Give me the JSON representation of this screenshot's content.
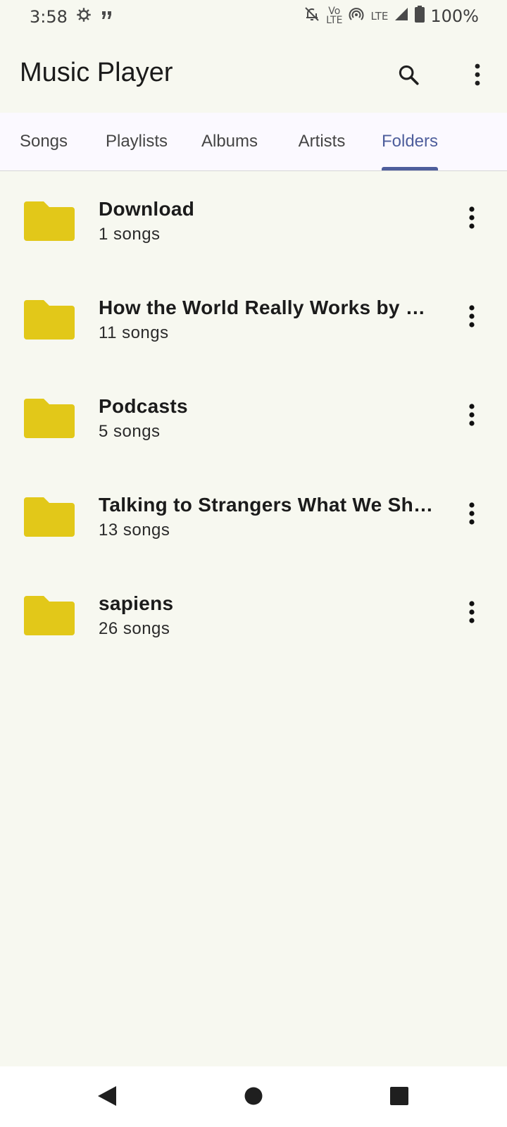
{
  "status_bar": {
    "time": "3:58",
    "volte_top": "Vo",
    "volte_bottom": "LTE",
    "network": "LTE",
    "battery": "100%"
  },
  "app_bar": {
    "title": "Music Player"
  },
  "tabs": [
    {
      "label": "Songs",
      "active": false
    },
    {
      "label": "Playlists",
      "active": false
    },
    {
      "label": "Albums",
      "active": false
    },
    {
      "label": "Artists",
      "active": false
    },
    {
      "label": "Folders",
      "active": true
    }
  ],
  "folders": [
    {
      "name": "Download",
      "count": "1 songs"
    },
    {
      "name": "How the World Really Works by Vac…",
      "count": "11 songs"
    },
    {
      "name": "Podcasts",
      "count": "5 songs"
    },
    {
      "name": "Talking to Strangers What We Shou…",
      "count": "13 songs"
    },
    {
      "name": "sapiens",
      "count": "26 songs"
    }
  ],
  "colors": {
    "accent": "#4e5e9c",
    "folder": "#e2c819",
    "background": "#f7f8f0"
  },
  "icons": {
    "status": [
      "gear-icon",
      "quote-icon",
      "bell-off-icon",
      "hotspot-icon",
      "signal-icon",
      "battery-icon"
    ],
    "app_bar": [
      "search-icon",
      "more-vert-icon"
    ],
    "row": [
      "folder-icon",
      "more-vert-icon"
    ],
    "nav": [
      "back-icon",
      "home-icon",
      "recents-icon"
    ]
  }
}
